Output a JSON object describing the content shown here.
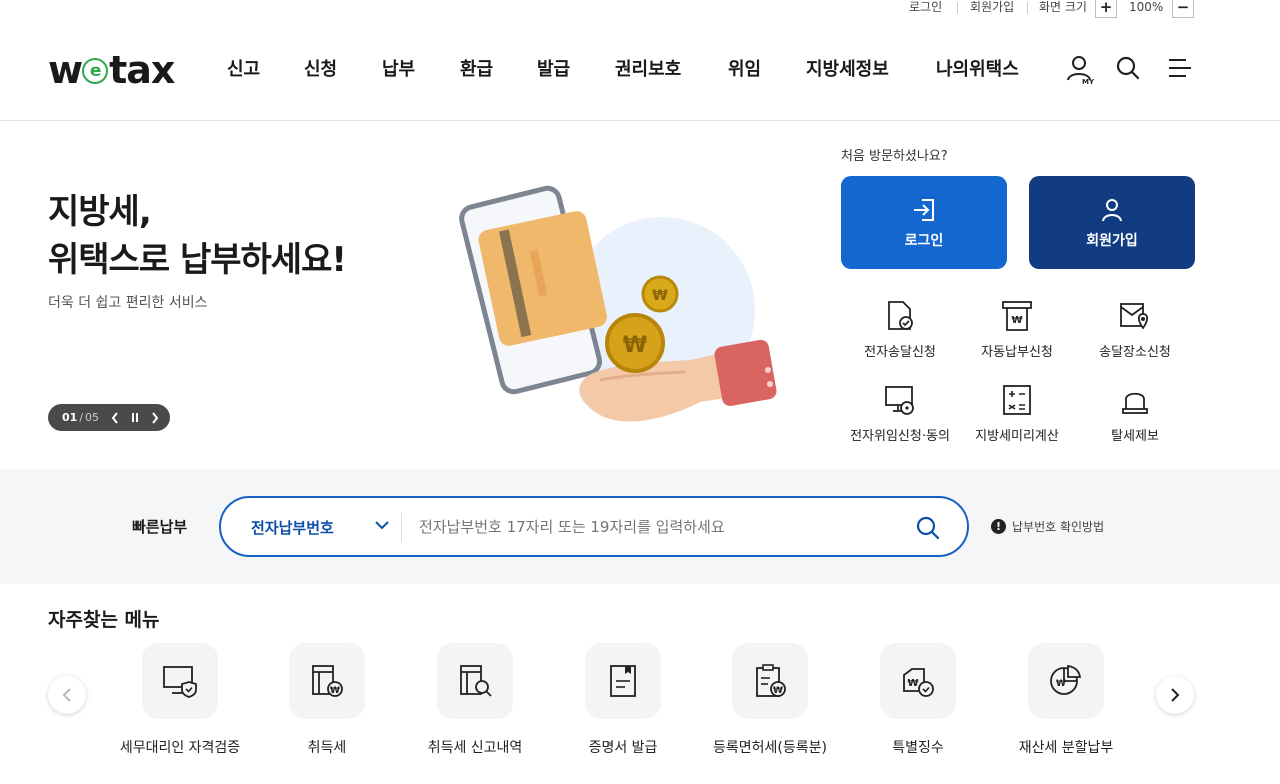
{
  "utility": {
    "login": "로그인",
    "signup": "회원가입",
    "zoom_label": "화면 크기",
    "zoom_in": "+",
    "zoom_value": "100%",
    "zoom_out": "−"
  },
  "header": {
    "logo_w": "w",
    "logo_e": "e",
    "logo_tax": "tax",
    "nav": [
      "신고",
      "신청",
      "납부",
      "환급",
      "발급",
      "권리보호",
      "위임",
      "지방세정보",
      "나의위택스"
    ],
    "my_badge": "MY"
  },
  "hero": {
    "title_line1": "지방세,",
    "title_line2": "위택스로 납부하세요!",
    "subtitle": "더욱 더 쉽고 편리한 서비스",
    "pager_current": "01",
    "pager_sep": "/",
    "pager_total": "05"
  },
  "side": {
    "visit_text": "처음 방문하셨나요?",
    "login_button": "로그인",
    "signup_button": "회원가입",
    "quick_links": [
      "전자송달신청",
      "자동납부신청",
      "송달장소신청",
      "전자위임신청·동의",
      "지방세미리계산",
      "탈세제보"
    ]
  },
  "quick_pay": {
    "label": "빠른납부",
    "select_value": "전자납부번호",
    "placeholder": "전자납부번호 17자리 또는 19자리를 입력하세요",
    "help_text": "납부번호 확인방법",
    "help_icon": "!"
  },
  "frequent": {
    "title": "자주찾는 메뉴",
    "items": [
      "세무대리인 자격검증",
      "취득세",
      "취득세 신고내역",
      "증명서 발급",
      "등록면허세(등록분)",
      "특별징수",
      "재산세 분할납부"
    ]
  },
  "colors": {
    "primary": "#1367cf",
    "navy": "#123c82",
    "accent_green": "#2fa84f"
  }
}
